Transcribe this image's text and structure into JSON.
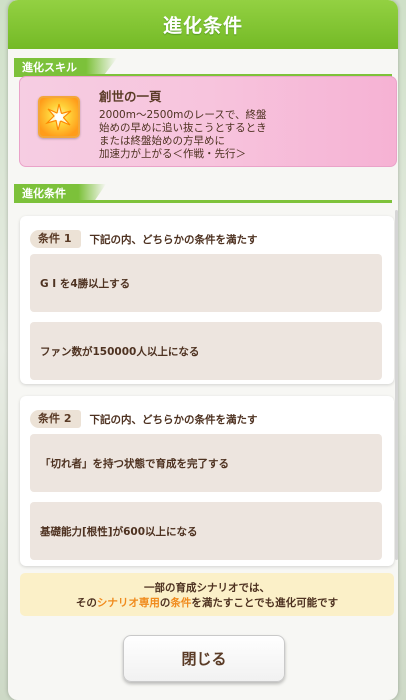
{
  "dialog": {
    "title": "進化条件"
  },
  "skill_section": {
    "label": "進化スキル",
    "skill": {
      "name": "創世の一頁",
      "icon": "sparkle-skill-icon",
      "description": [
        "2000m～2500mのレースで、終盤",
        "始めの早めに追い抜こうとするとき",
        "または終盤始めの方早めに",
        "加速力が上がる＜作戦・先行＞"
      ]
    }
  },
  "conditions_section": {
    "label": "進化条件",
    "conditions": [
      {
        "tag": "条件 1",
        "desc": "下記の内、どちらかの条件を満たす",
        "items": [
          "G I を4勝以上する",
          "ファン数が150000人以上になる"
        ]
      },
      {
        "tag": "条件 2",
        "desc": "下記の内、どちらかの条件を満たす",
        "items": [
          "「切れ者」を持つ状態で育成を完了する",
          "基礎能力[根性]が600以上になる"
        ]
      }
    ]
  },
  "note": {
    "line1": "一部の育成シナリオでは、",
    "line2_pre": "その",
    "line2_highlight1": "シナリオ専用",
    "line2_mid": "の",
    "line2_highlight2": "条件",
    "line2_post": "を満たすことでも進化可能です"
  },
  "buttons": {
    "close": "閉じる"
  },
  "colors": {
    "header": "#7cc13a",
    "skill_card": "#f7c4dd",
    "accent": "#f08a1c",
    "note_bg": "#fbf0c8"
  }
}
